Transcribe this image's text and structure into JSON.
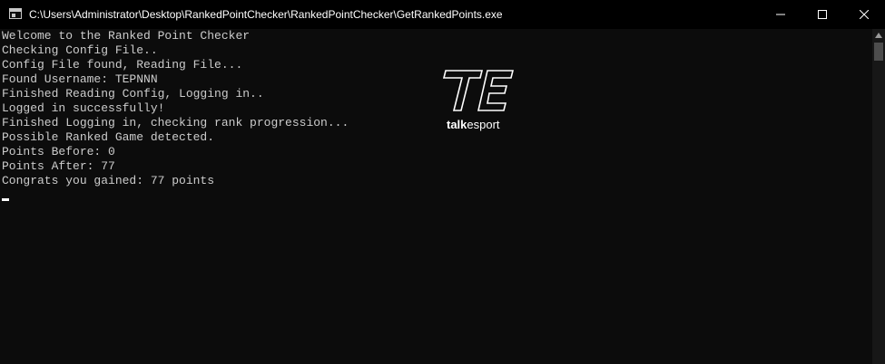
{
  "window": {
    "title": "C:\\Users\\Administrator\\Desktop\\RankedPointChecker\\RankedPointChecker\\GetRankedPoints.exe"
  },
  "console": {
    "lines": [
      "Welcome to the Ranked Point Checker",
      "Checking Config File..",
      "Config File found, Reading File...",
      "Found Username: TEPNNN",
      "Finished Reading Config, Logging in..",
      "Logged in successfully!",
      "Finished Logging in, checking rank progression...",
      "Possible Ranked Game detected.",
      "Points Before: 0",
      "Points After: 77",
      "Congrats you gained: 77 points"
    ]
  },
  "watermark": {
    "brand_bold": "talk",
    "brand_rest": "esport"
  },
  "icons": {
    "app": "console-app-icon",
    "minimize": "minimize-icon",
    "maximize": "maximize-icon",
    "close": "close-icon",
    "scroll_up": "scroll-up-arrow-icon"
  },
  "colors": {
    "background": "#0c0c0c",
    "titlebar": "#000000",
    "text": "#cccccc"
  }
}
